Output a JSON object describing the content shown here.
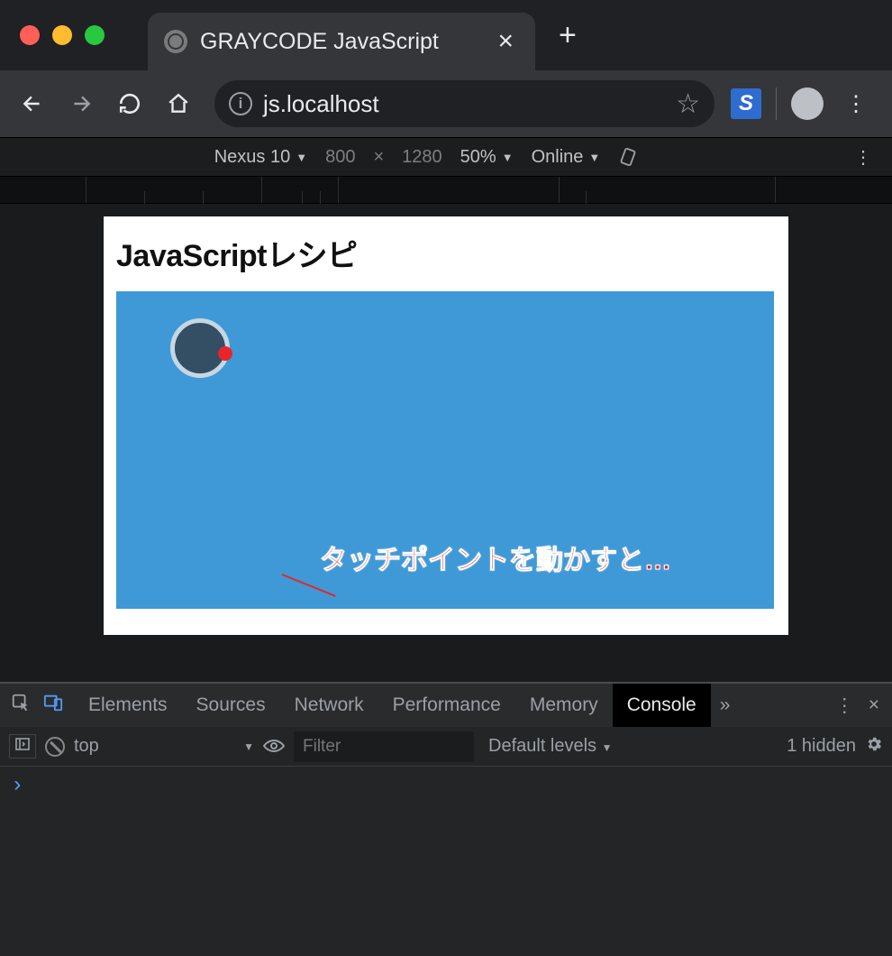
{
  "window": {
    "tab_title": "GRAYCODE JavaScript",
    "new_tab_glyph": "+",
    "close_glyph": "×"
  },
  "addrbar": {
    "info_glyph": "i",
    "url": "js.localhost",
    "star_glyph": "☆",
    "ext_letter": "S",
    "kebab": "⋮"
  },
  "device_toolbar": {
    "device": "Nexus 10",
    "width": "800",
    "x": "×",
    "height": "1280",
    "zoom": "50%",
    "network": "Online",
    "rotate_glyph": "⟲",
    "more": "⋮"
  },
  "page": {
    "heading": "JavaScriptレシピ",
    "annotation": "タッチポイントを動かすと…"
  },
  "devtools": {
    "tabs": [
      "Elements",
      "Sources",
      "Network",
      "Performance",
      "Memory",
      "Console"
    ],
    "active_tab": "Console",
    "overflow": "»",
    "more": "⋮",
    "close": "×"
  },
  "console_bar": {
    "context": "top",
    "filter_placeholder": "Filter",
    "levels": "Default levels",
    "hidden": "1 hidden"
  },
  "console": {
    "prompt": "›"
  }
}
